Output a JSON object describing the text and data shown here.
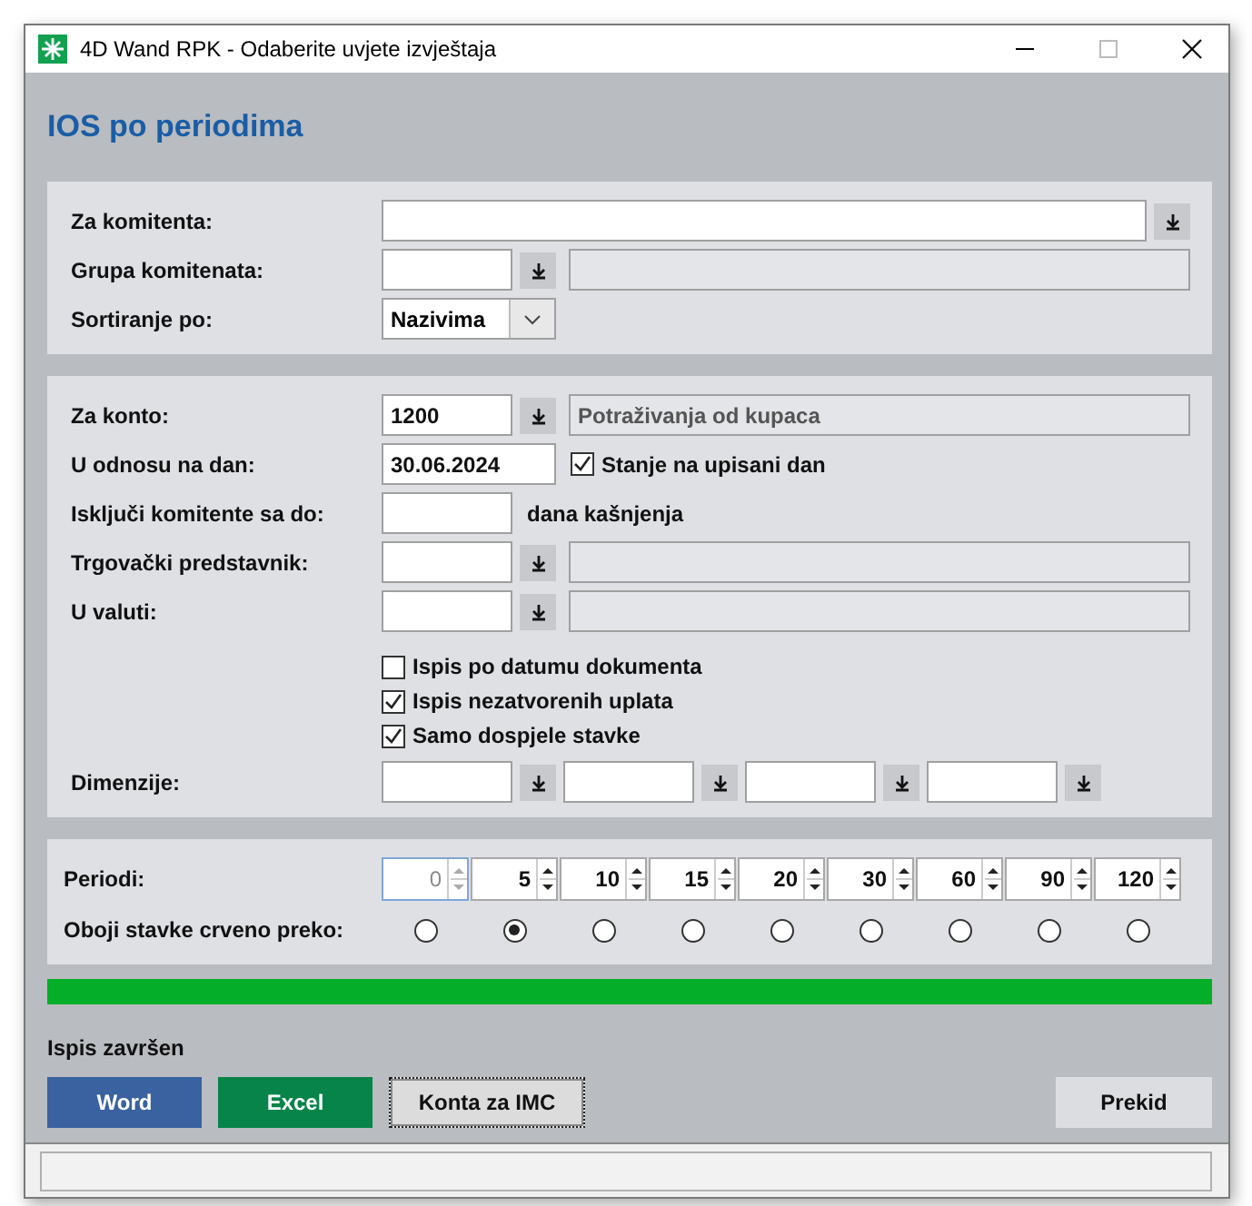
{
  "window": {
    "title": "4D Wand RPK - Odaberite uvjete izvještaja"
  },
  "heading": "IOS po periodima",
  "section_1": [
    {
      "kind": "wide_lookup",
      "label": "Za komitenta:"
    },
    {
      "kind": "lookup",
      "label": "Grupa komitenata:"
    },
    {
      "kind": "select",
      "label": "Sortiranje po:",
      "value": "Nazivima"
    }
  ],
  "section_2": [
    {
      "kind": "lookup",
      "label": "Za konto:",
      "value": "1200",
      "description": "Potraživanja od kupaca"
    },
    {
      "kind": "date_check",
      "label": "U odnosu na dan:",
      "value": "30.06.2024",
      "check": {
        "label": "Stanje na upisani dan",
        "checked": true
      }
    },
    {
      "kind": "suffix",
      "label": "Isključi komitente sa do:",
      "suffix": "dana kašnjenja"
    },
    {
      "kind": "lookup",
      "label": "Trgovački predstavnik:"
    },
    {
      "kind": "lookup",
      "label": "U valuti:"
    },
    {
      "kind": "checks",
      "items": [
        {
          "label": "Ispis po datumu dokumenta",
          "checked": false
        },
        {
          "label": "Ispis nezatvorenih uplata",
          "checked": true
        },
        {
          "label": "Samo dospjele stavke",
          "checked": true
        }
      ]
    },
    {
      "kind": "multi_lookup",
      "label": "Dimenzije:",
      "fields": [
        {
          "disabled": false
        },
        {
          "disabled": false
        },
        {
          "disabled": false
        },
        {
          "disabled": false
        }
      ]
    }
  ],
  "periods": {
    "label": "Periodi:",
    "radio_label": "Oboji stavke crveno preko:",
    "items": [
      {
        "value": "0",
        "disabled": true,
        "selected": false
      },
      {
        "value": "5",
        "disabled": false,
        "selected": true
      },
      {
        "value": "10",
        "disabled": false,
        "selected": false
      },
      {
        "value": "15",
        "disabled": false,
        "selected": false
      },
      {
        "value": "20",
        "disabled": false,
        "selected": false
      },
      {
        "value": "30",
        "disabled": false,
        "selected": false
      },
      {
        "value": "60",
        "disabled": false,
        "selected": false
      },
      {
        "value": "90",
        "disabled": false,
        "selected": false
      },
      {
        "value": "120",
        "disabled": false,
        "selected": false
      }
    ]
  },
  "progress": {
    "level": 1
  },
  "status_text": "Ispis završen",
  "buttons": [
    {
      "label": "Word",
      "kind": "word"
    },
    {
      "label": "Excel",
      "kind": "excel"
    },
    {
      "label": "Konta za IMC",
      "kind": "focused"
    },
    {
      "label": "Prekid",
      "kind": "plain"
    }
  ]
}
